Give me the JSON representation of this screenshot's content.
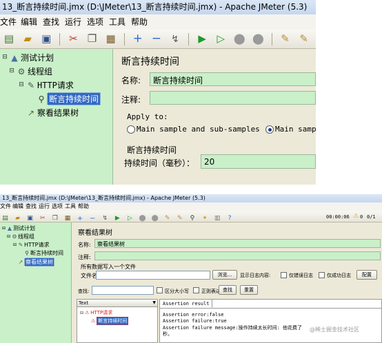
{
  "shot1": {
    "title": "13_断言持续时间.jmx (D:\\JMeter\\13_断言持续时间.jmx) - Apache JMeter (5.3)",
    "menu": [
      "文件",
      "编辑",
      "查找",
      "运行",
      "选项",
      "工具",
      "帮助"
    ],
    "tree": {
      "test_plan": "测试计划",
      "thread_group": "线程组",
      "http_request": "HTTP请求",
      "assertion": "断言持续时间",
      "result_tree": "察看结果树"
    },
    "panel": {
      "heading": "断言持续时间",
      "name_label": "名称:",
      "name_value": "断言持续时间",
      "comment_label": "注释:",
      "apply_to": "Apply to:",
      "radio_main_sub": "Main sample and sub-samples",
      "radio_main": "Main samp",
      "section_title": "断言持续时间",
      "duration_label": "持续时间（毫秒）：",
      "duration_value": "20"
    }
  },
  "shot2": {
    "title": "13_断言持续时间.jmx (D:\\JMeter\\13_断言持续时间.jmx) - Apache JMeter (5.3)",
    "menu": [
      "文件",
      "编辑",
      "查找",
      "运行",
      "选项",
      "工具",
      "帮助"
    ],
    "timer": "00:00:06",
    "warn_count": "0",
    "thread_count": "0/1",
    "tree": {
      "test_plan": "测试计划",
      "thread_group": "线程组",
      "http_request": "HTTP请求",
      "assertion": "断言持续时间",
      "result_tree": "察看结果树"
    },
    "panel": {
      "heading": "察看结果树",
      "name_label": "名称:",
      "name_value": "察看结果树",
      "comment_label": "注释:",
      "write_all": "所有数据写入一个文件",
      "file_label": "文件名",
      "browse": "浏览...",
      "log_content": "显示日志内容:",
      "errors_only": "仅错误日志",
      "success_only": "仅成功日志",
      "configure": "配置",
      "search_label": "查找:",
      "case_sensitive": "区分大小写",
      "regex": "正则表达式",
      "search_btn": "查找",
      "reset_btn": "重置",
      "renderer": "Text",
      "result_http": "HTTP请求",
      "result_assertion": "断言持续时间",
      "tab_assertion": "Assertion result",
      "assert_error": "Assertion error:false",
      "assert_failure": "Assertion failure:true",
      "assert_message_1": "Assertion failure message:操作持续太长时间: 他花费了",
      "assert_message_2": "秒。",
      "watermark": "@稀土掘金技术社区"
    }
  }
}
